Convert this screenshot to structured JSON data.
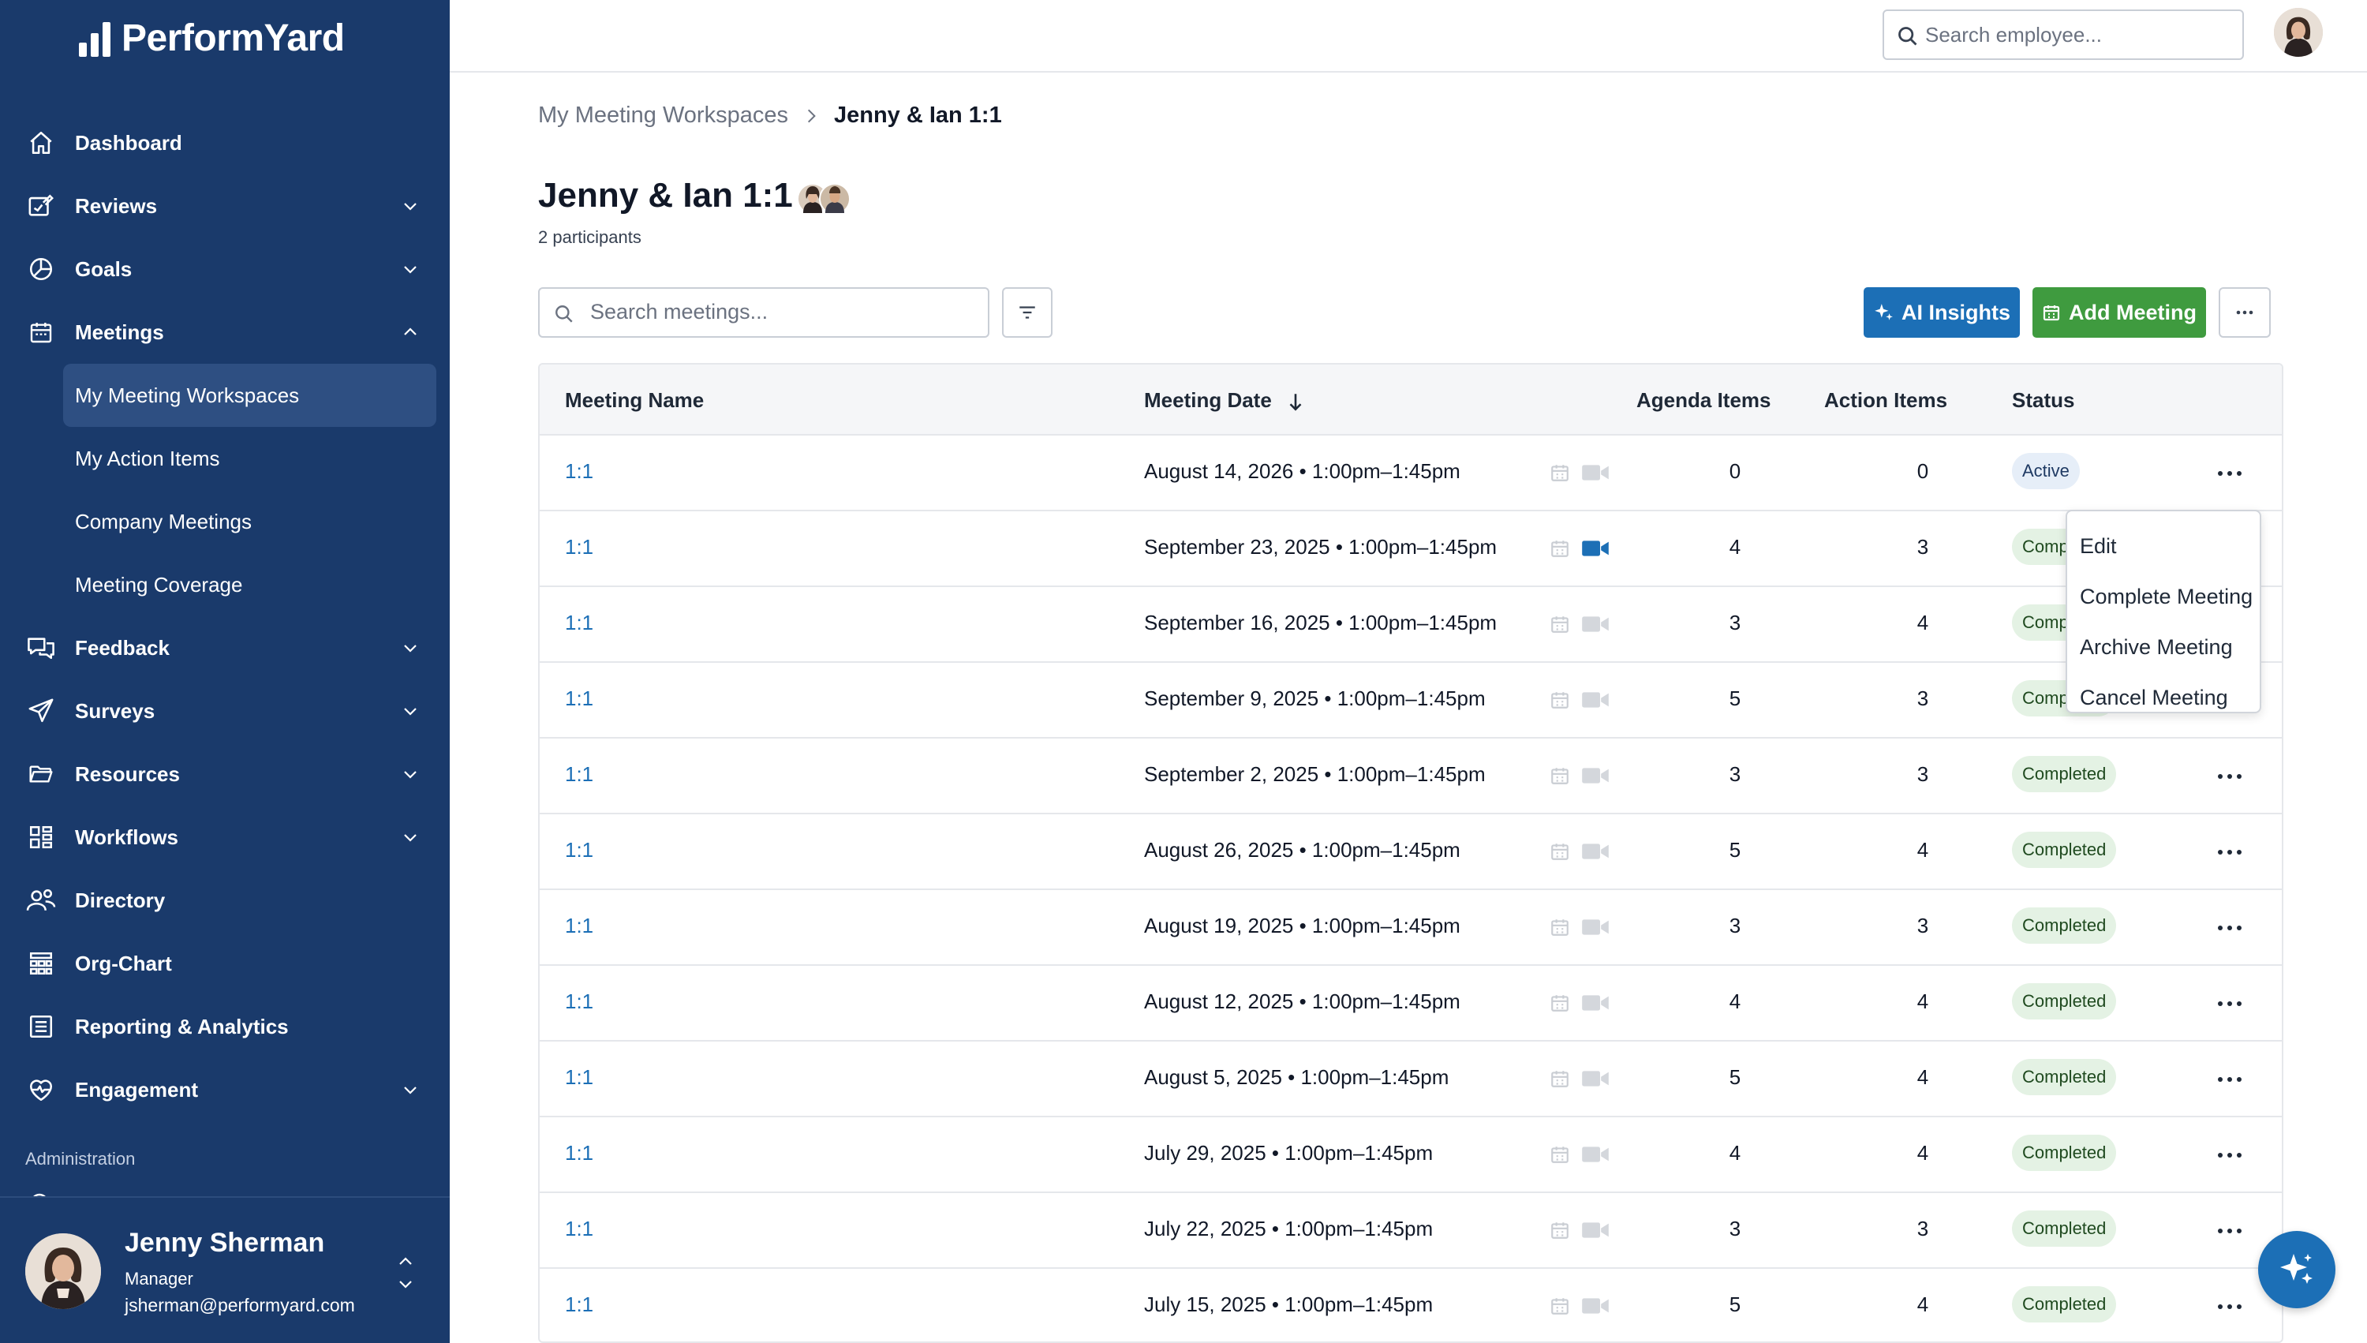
{
  "brand": {
    "name": "PerformYard"
  },
  "sidebar": {
    "nav": [
      {
        "label": "Dashboard",
        "icon": "home-icon"
      },
      {
        "label": "Reviews",
        "icon": "reviews-icon"
      },
      {
        "label": "Goals",
        "icon": "goals-icon"
      },
      {
        "label": "Meetings",
        "icon": "meetings-icon"
      }
    ],
    "meeting_sub": [
      {
        "label": "My Meeting Workspaces"
      },
      {
        "label": "My Action Items"
      },
      {
        "label": "Company Meetings"
      },
      {
        "label": "Meeting Coverage"
      }
    ],
    "nav_after": [
      {
        "label": "Feedback",
        "icon": "feedback-icon"
      },
      {
        "label": "Surveys",
        "icon": "surveys-icon"
      },
      {
        "label": "Resources",
        "icon": "folder-icon"
      },
      {
        "label": "Workflows",
        "icon": "workflows-icon"
      },
      {
        "label": "Directory",
        "icon": "directory-icon"
      },
      {
        "label": "Org-Chart",
        "icon": "org-chart-icon"
      },
      {
        "label": "Reporting & Analytics",
        "icon": "report-icon"
      },
      {
        "label": "Engagement",
        "icon": "engagement-icon"
      }
    ],
    "admin_label": "Administration",
    "user": {
      "name": "Jenny Sherman",
      "role": "Manager",
      "email": "jsherman@performyard.com"
    }
  },
  "topbar": {
    "search_placeholder": "Search employee..."
  },
  "breadcrumb": {
    "parent": "My Meeting Workspaces",
    "current": "Jenny & Ian 1:1"
  },
  "page": {
    "title": "Jenny & Ian 1:1",
    "participants": "2 participants"
  },
  "toolbar": {
    "search_placeholder": "Search meetings...",
    "ai_label": "AI Insights",
    "add_label": "Add Meeting"
  },
  "table": {
    "headers": {
      "name": "Meeting Name",
      "date": "Meeting Date",
      "agenda": "Agenda Items",
      "action": "Action Items",
      "status": "Status"
    },
    "rows": [
      {
        "name": "1:1",
        "date": "August 14, 2026 • 1:00pm–1:45pm",
        "agenda": "0",
        "action": "0",
        "status": "Active",
        "video_active": false
      },
      {
        "name": "1:1",
        "date": "September 23, 2025 • 1:00pm–1:45pm",
        "agenda": "4",
        "action": "3",
        "status": "Completed",
        "video_active": true
      },
      {
        "name": "1:1",
        "date": "September 16, 2025 • 1:00pm–1:45pm",
        "agenda": "3",
        "action": "4",
        "status": "Completed",
        "video_active": false
      },
      {
        "name": "1:1",
        "date": "September 9, 2025 • 1:00pm–1:45pm",
        "agenda": "5",
        "action": "3",
        "status": "Completed",
        "video_active": false
      },
      {
        "name": "1:1",
        "date": "September 2, 2025 • 1:00pm–1:45pm",
        "agenda": "3",
        "action": "3",
        "status": "Completed",
        "video_active": false
      },
      {
        "name": "1:1",
        "date": "August 26, 2025 • 1:00pm–1:45pm",
        "agenda": "5",
        "action": "4",
        "status": "Completed",
        "video_active": false
      },
      {
        "name": "1:1",
        "date": "August 19, 2025 • 1:00pm–1:45pm",
        "agenda": "3",
        "action": "3",
        "status": "Completed",
        "video_active": false
      },
      {
        "name": "1:1",
        "date": "August 12, 2025 • 1:00pm–1:45pm",
        "agenda": "4",
        "action": "4",
        "status": "Completed",
        "video_active": false
      },
      {
        "name": "1:1",
        "date": "August 5, 2025 • 1:00pm–1:45pm",
        "agenda": "5",
        "action": "4",
        "status": "Completed",
        "video_active": false
      },
      {
        "name": "1:1",
        "date": "July 29, 2025 • 1:00pm–1:45pm",
        "agenda": "4",
        "action": "4",
        "status": "Completed",
        "video_active": false
      },
      {
        "name": "1:1",
        "date": "July 22, 2025 • 1:00pm–1:45pm",
        "agenda": "3",
        "action": "3",
        "status": "Completed",
        "video_active": false
      },
      {
        "name": "1:1",
        "date": "July 15, 2025 • 1:00pm–1:45pm",
        "agenda": "5",
        "action": "4",
        "status": "Completed",
        "video_active": false
      }
    ]
  },
  "row_menu": {
    "items": [
      {
        "label": "Edit"
      },
      {
        "label": "Complete Meeting"
      },
      {
        "label": "Archive Meeting"
      },
      {
        "label": "Cancel Meeting"
      }
    ]
  },
  "colors": {
    "sidebar_bg": "#1a3a6b",
    "accent_blue": "#1c6fb6",
    "accent_green": "#3f9b3f",
    "badge_completed_bg": "#e4f2e4",
    "badge_active_bg": "#e6eef8"
  }
}
